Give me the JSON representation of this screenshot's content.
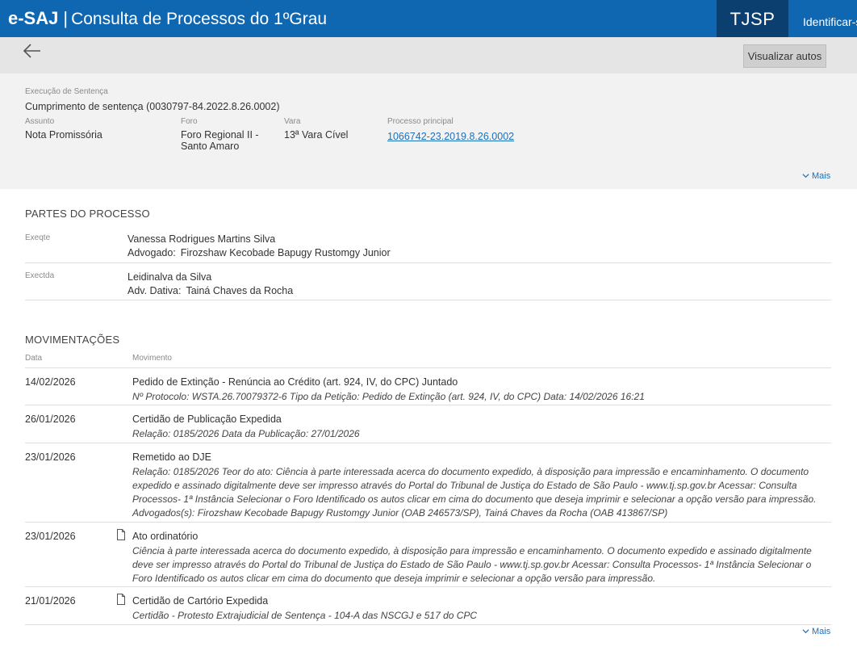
{
  "topbar": {
    "logo": "e-SAJ",
    "separator": "|",
    "system_title": "Consulta de Processos do 1ºGrau",
    "court": "TJSP",
    "identify_label": "Identificar-se",
    "color": "#0f66b1"
  },
  "toolbar": {
    "back_icon": "arrow-left-icon",
    "view_button_label": "Visualizar autos"
  },
  "process": {
    "class_label": "Execução de Sentença",
    "class_value": "Cumprimento de sentença (0030797-84.2022.8.26.0002)",
    "subject_label": "Assunto",
    "subject_value": "Nota Promissória",
    "forum_label": "Foro",
    "forum_value_line1": "Foro Regional II -",
    "forum_value_line2": "Santo Amaro",
    "court_division_label": "Vara",
    "court_division_value": "13ª Vara Cível",
    "main_process_label": "Processo principal",
    "main_process_value": "1066742-23.2019.8.26.0002",
    "more_label": "Mais"
  },
  "parties": {
    "title": "PARTES DO PROCESSO",
    "items": [
      {
        "role": "Exeqte",
        "name": "Vanessa Rodrigues Martins Silva",
        "lawyer_label": "Advogado:",
        "lawyer_name": "Firozshaw Kecobade Bapugy Rustomgy Junior"
      },
      {
        "role": "Exectda",
        "name": "Leidinalva da Silva",
        "lawyer_label": "Adv. Dativa:",
        "lawyer_name": "Tainá Chaves da Rocha"
      }
    ]
  },
  "movements": {
    "title": "MOVIMENTAÇÕES",
    "col_date": "Data",
    "col_movement": "Movimento",
    "more_label": "Mais",
    "items": [
      {
        "date": "14/02/2026",
        "title": "Pedido de Extinção - Renúncia ao Crédito (art. 924, IV, do CPC) Juntado",
        "desc": "Nº Protocolo: WSTA.26.70079372-6 Tipo da Petição: Pedido de Extinção (art. 924, IV, do CPC) Data: 14/02/2026 16:21",
        "has_doc": false
      },
      {
        "date": "26/01/2026",
        "title": "Certidão de Publicação Expedida",
        "desc": "Relação: 0185/2026 Data da Publicação: 27/01/2026",
        "has_doc": false
      },
      {
        "date": "23/01/2026",
        "title": "Remetido ao DJE",
        "desc": "Relação: 0185/2026 Teor do ato: Ciência à parte interessada acerca do documento expedido, à disposição para impressão e encaminhamento. O documento expedido e assinado digitalmente deve ser impresso através do Portal do Tribunal de Justiça do Estado de São Paulo - www.tj.sp.gov.br Acessar: Consulta Processos- 1ª Instância Selecionar o Foro Identificado os autos clicar em cima do documento que deseja imprimir e selecionar a opção versão para impressão. Advogados(s): Firozshaw Kecobade Bapugy Rustomgy Junior (OAB 246573/SP), Tainá Chaves da Rocha (OAB 413867/SP)",
        "has_doc": false
      },
      {
        "date": "23/01/2026",
        "title": "Ato ordinatório",
        "desc": "Ciência à parte interessada acerca do documento expedido, à disposição para impressão e encaminhamento. O documento expedido e assinado digitalmente deve ser impresso através do Portal do Tribunal de Justiça do Estado de São Paulo - www.tj.sp.gov.br Acessar: Consulta Processos- 1ª Instância Selecionar o Foro Identificado os autos clicar em cima do documento que deseja imprimir e selecionar a opção versão para impressão.",
        "has_doc": true,
        "doc_icon": "document-icon"
      },
      {
        "date": "21/01/2026",
        "title": "Certidão de Cartório Expedida",
        "desc": "Certidão - Protesto Extrajudicial de Sentença - 104-A das NSCGJ e 517 do CPC",
        "has_doc": true,
        "doc_icon": "document-icon"
      }
    ]
  }
}
